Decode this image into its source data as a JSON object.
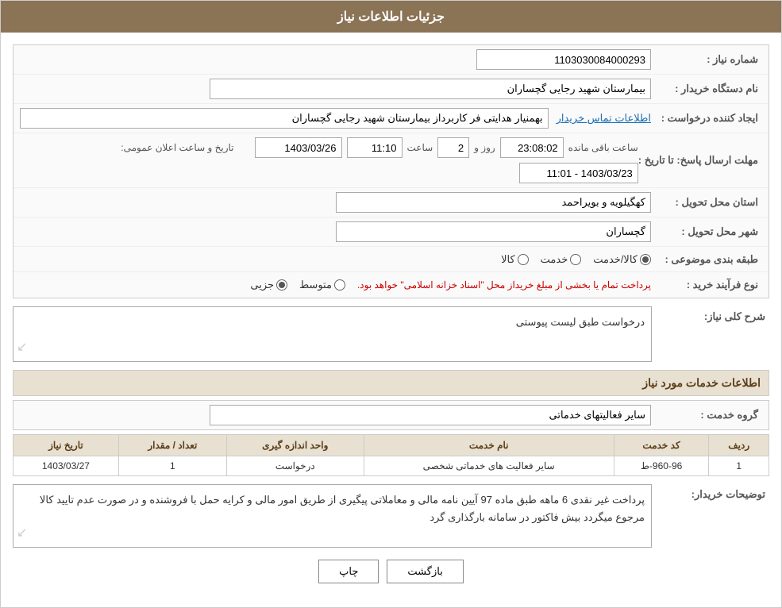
{
  "header": {
    "title": "جزئیات اطلاعات نیاز"
  },
  "fields": {
    "shomareNiaz_label": "شماره نیاز :",
    "shomareNiaz_value": "1103030084000293",
    "namDasgah_label": "نام دستگاه خریدار :",
    "namDasgah_value": "بیمارستان شهید رجایی گچساران",
    "ijadKonande_label": "ایجاد کننده درخواست :",
    "ijadKonande_value": "بهمنیار هدایتی فر کاربرداز بیمارستان شهید رجایی گچساران",
    "ijadKonande_link": "اطلاعات تماس خریدار",
    "mohlatErsalPasokh_label": "مهلت ارسال پاسخ: تا تاریخ :",
    "tarikhVaSaatElan_label": "تاریخ و ساعت اعلان عمومی:",
    "tarikhVaSaatElan_value": "1403/03/23 - 11:01",
    "tarikhPasokh_date": "1403/03/26",
    "saatPasokh_label": "ساعت",
    "saatPasokh_value": "11:10",
    "rooz_label": "روز و",
    "rooz_value": "2",
    "saatBaghimandeh_time": "23:08:02",
    "saatBaghimandeh_label": "ساعت باقی مانده",
    "ostanMahaliTahvil_label": "استان محل تحویل :",
    "ostanMahaliTahvil_value": "کهگیلویه و بویراحمد",
    "shahrMahaliTahvil_label": "شهر محل تحویل :",
    "shahrMahaliTahvil_value": "گچساران",
    "tabaqeBandiyeMovzooyi_label": "طبقه بندی موضوعی :",
    "kala_label": "کالا",
    "khadamat_label": "خدمت",
    "kalaKhadamat_label": "کالا/خدمت",
    "noeFarayandKharid_label": "نوع فرآیند خرید :",
    "jozyi_label": "جزیی",
    "motavasset_label": "متوسط",
    "farayandText": "پرداخت تمام یا بخشی از مبلغ خریداز محل \"اسناد خزانه اسلامی\" خواهد بود.",
    "sharhKoliNiaz_label": "شرح کلی نیاز:",
    "sharhKoliNiaz_value": "درخواست طبق لیست پیوستی",
    "ettelaatKhadamat_header": "اطلاعات خدمات مورد نیاز",
    "groupKhadamat_label": "گروه خدمت :",
    "groupKhadamat_value": "سایر فعالیتهای خدماتی",
    "table": {
      "headers": [
        "ردیف",
        "کد خدمت",
        "نام خدمت",
        "واحد اندازه گیری",
        "تعداد / مقدار",
        "تاریخ نیاز"
      ],
      "rows": [
        {
          "radif": "1",
          "kodKhadamat": "960-96-ط",
          "namKhadamat": "سایر فعالیت های خدماتی شخصی",
          "vahedAndaze": "درخواست",
          "tedad": "1",
          "tarikhNiaz": "1403/03/27"
        }
      ]
    },
    "tosihKhardar_label": "توضیحات خریدار:",
    "tosihKhardar_value": "پرداخت غیر نقدی 6 ماهه  طبق ماده 97 آیین نامه مالی و معاملاتی پیگیری از طریق امور مالی  و  کرایه حمل با فروشنده و در صورت عدم تایید کالا مرجوع میگردد بیش فاکتور در سامانه بارگذاری گرد",
    "buttons": {
      "chap_label": "چاپ",
      "bazgasht_label": "بازگشت"
    }
  }
}
